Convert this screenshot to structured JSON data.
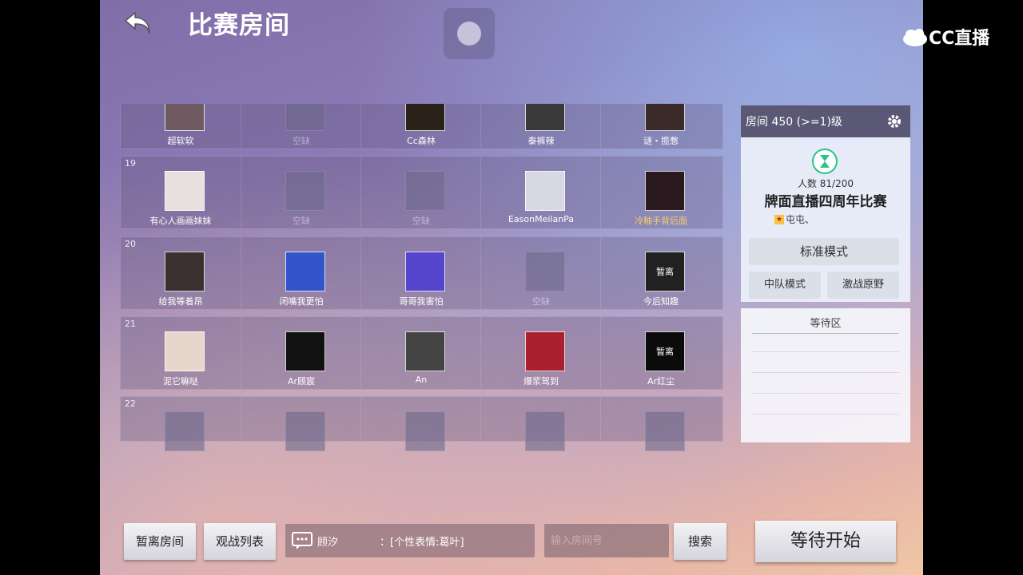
{
  "header": {
    "title": "比赛房间"
  },
  "watermark": {
    "brand": "CC直播"
  },
  "rows": [
    {
      "num": "",
      "slots": [
        {
          "name": "超软软",
          "state": "avatar",
          "color": "#6e5a60"
        },
        {
          "name": "空缺",
          "state": "empty"
        },
        {
          "name": "Cc森林",
          "state": "avatar",
          "color": "#2a2218"
        },
        {
          "name": "泰裤辣",
          "state": "avatar",
          "color": "#3a3a3a"
        },
        {
          "name": "谜・揽憋",
          "state": "avatar",
          "color": "#3b2a2a"
        }
      ]
    },
    {
      "num": "19",
      "slots": [
        {
          "name": "有心人画画妹妹",
          "state": "avatar",
          "color": "#e8e0e0"
        },
        {
          "name": "空缺",
          "state": "empty"
        },
        {
          "name": "空缺",
          "state": "empty"
        },
        {
          "name": "EasonMeilanPa",
          "state": "avatar",
          "color": "#d8d8e2"
        },
        {
          "name": "冷釉手背后面",
          "state": "avatar",
          "color": "#2a1a20",
          "gold": true
        }
      ]
    },
    {
      "num": "20",
      "slots": [
        {
          "name": "给我等着昂",
          "state": "avatar",
          "color": "#3a3030"
        },
        {
          "name": "闭嘴我更怕",
          "state": "avatar",
          "color": "#3355cc"
        },
        {
          "name": "哥哥我害怕",
          "state": "avatar",
          "color": "#5544cc"
        },
        {
          "name": "空缺",
          "state": "empty"
        },
        {
          "name": "今后知趣",
          "state": "avatar",
          "color": "#333333",
          "away": "暂离"
        }
      ]
    },
    {
      "num": "21",
      "slots": [
        {
          "name": "泥它嘛哒",
          "state": "avatar",
          "color": "#e6d6cc"
        },
        {
          "name": "Ar顾宸",
          "state": "avatar",
          "color": "#111111"
        },
        {
          "name": "An",
          "state": "avatar",
          "color": "#444444"
        },
        {
          "name": "爆浆驾到",
          "state": "avatar",
          "color": "#aa2030"
        },
        {
          "name": "Ar红尘",
          "state": "avatar",
          "color": "#111111",
          "away": "暂离"
        }
      ]
    },
    {
      "num": "22",
      "slots": [
        {
          "name": "",
          "state": "empty"
        },
        {
          "name": "",
          "state": "empty"
        },
        {
          "name": "",
          "state": "empty"
        },
        {
          "name": "",
          "state": "empty"
        },
        {
          "name": "",
          "state": "empty"
        }
      ]
    }
  ],
  "side": {
    "room_label": "房间 450 (>=1)级",
    "count": "人数 81/200",
    "match_name": "牌面直播四周年比赛",
    "owner": "屯屯、",
    "mode_standard": "标准模式",
    "mode_team": "中队模式",
    "mode_battle": "激战原野",
    "waiting_area": "等待区"
  },
  "bottom": {
    "away_button": "暂离房间",
    "spectator_button": "观战列表",
    "chat_user": "顾汐",
    "chat_message": "：[个性表情:葛叶]",
    "search_placeholder": "输入房间号",
    "search_button": "搜索",
    "start_button": "等待开始"
  },
  "icons": {
    "back": "back-arrow-icon",
    "gear": "gear-icon",
    "chat": "chat-bubble-icon",
    "hourglass": "hourglass-icon",
    "star": "star-icon",
    "camera": "camera-icon"
  }
}
